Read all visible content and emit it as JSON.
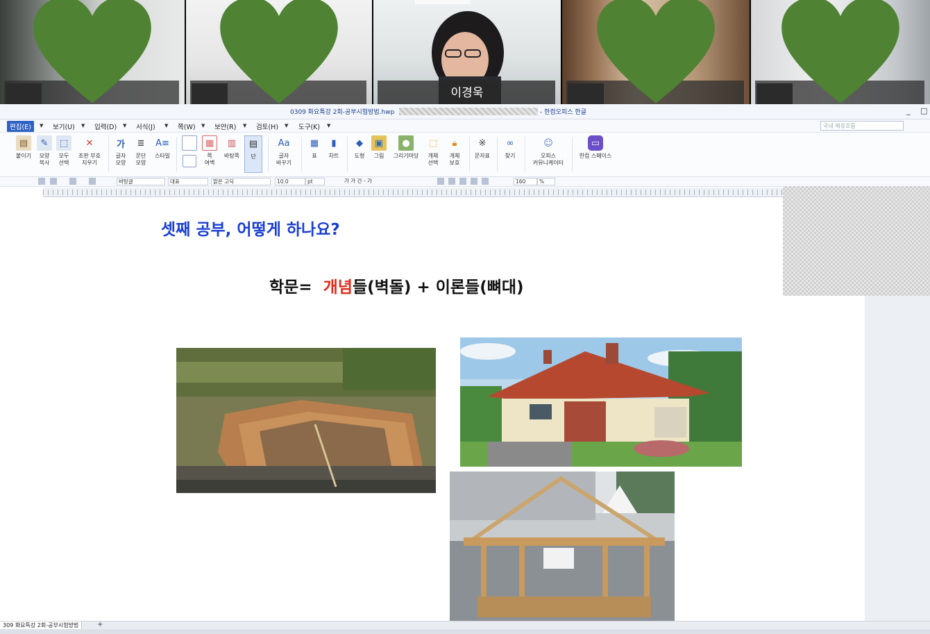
{
  "video_call": {
    "participants": [
      {
        "name": "",
        "avatar": "heart-icon",
        "heart_color": "#4f8233"
      },
      {
        "name": "",
        "avatar": "heart-icon",
        "heart_color": "#4f8233"
      },
      {
        "name": "이경욱",
        "avatar": "video"
      },
      {
        "name": "",
        "avatar": "heart-icon",
        "heart_color": "#4f8233"
      },
      {
        "name": "",
        "avatar": "heart-icon",
        "heart_color": "#4f8233"
      }
    ]
  },
  "window": {
    "title": "0309 화요특강 2회-공부시험방법.hwp",
    "app_name": "- 한컴오피스 한글",
    "min_label": "_",
    "max_label": "□"
  },
  "menu": {
    "items": [
      "편집(E)",
      "보기(U)",
      "입력(D)",
      "서식(J)",
      "쪽(W)",
      "보안(R)",
      "검토(H)",
      "도구(K)"
    ],
    "search_placeholder": "국내 해류흐름"
  },
  "ribbon": {
    "buttons": [
      {
        "label": "붙이기",
        "icon": "paste-icon"
      },
      {
        "label": "모양\n복사",
        "icon": "format-painter-icon"
      },
      {
        "label": "모두\n선택",
        "icon": "select-all-icon"
      },
      {
        "label": "조판 부호\n지우기",
        "icon": "clear-format-icon"
      },
      {
        "label": "글자\n모양",
        "icon": "char-shape-icon"
      },
      {
        "label": "문단\n모양",
        "icon": "para-shape-icon"
      },
      {
        "label": "스타일",
        "icon": "style-icon"
      },
      {
        "label": "쪽\n여백",
        "icon": "page-margin-icon"
      },
      {
        "label": "바탕쪽",
        "icon": "master-page-icon"
      },
      {
        "label": "단",
        "icon": "columns-icon"
      },
      {
        "label": "글자\n바꾸기",
        "icon": "replace-char-icon"
      },
      {
        "label": "표",
        "icon": "table-icon"
      },
      {
        "label": "차트",
        "icon": "chart-icon"
      },
      {
        "label": "도형",
        "icon": "shape-icon"
      },
      {
        "label": "그림",
        "icon": "picture-icon"
      },
      {
        "label": "그리기마당",
        "icon": "clipart-icon"
      },
      {
        "label": "개체\n선택",
        "icon": "object-select-icon"
      },
      {
        "label": "개체\n보호",
        "icon": "object-protect-icon"
      },
      {
        "label": "문자표",
        "icon": "symbol-icon"
      },
      {
        "label": "찾기",
        "icon": "find-icon"
      },
      {
        "label": "오피스\n커뮤니케이터",
        "icon": "communicator-icon"
      },
      {
        "label": "한컴 스페이스",
        "icon": "hancom-space-icon"
      }
    ]
  },
  "format_bar": {
    "style": "바탕글",
    "lang": "대표",
    "font": "맑은 고딕",
    "size": "10.0",
    "unit": "pt",
    "char_buttons": "가 가 간 - 가",
    "line_spacing": "160",
    "line_unit": "%"
  },
  "document": {
    "title": "셋째 공부, 어떻게 하나요?",
    "formula_left": "학문=",
    "formula_highlight": "개념",
    "formula_rest": "들(벽돌)  +  이론들(뼈대)",
    "colors": {
      "title": "#1a3fd2",
      "highlight": "#e02a1a"
    }
  },
  "status": {
    "tab_label": "309 화요특강 2회-공부시험방법",
    "add_tab": "+"
  }
}
